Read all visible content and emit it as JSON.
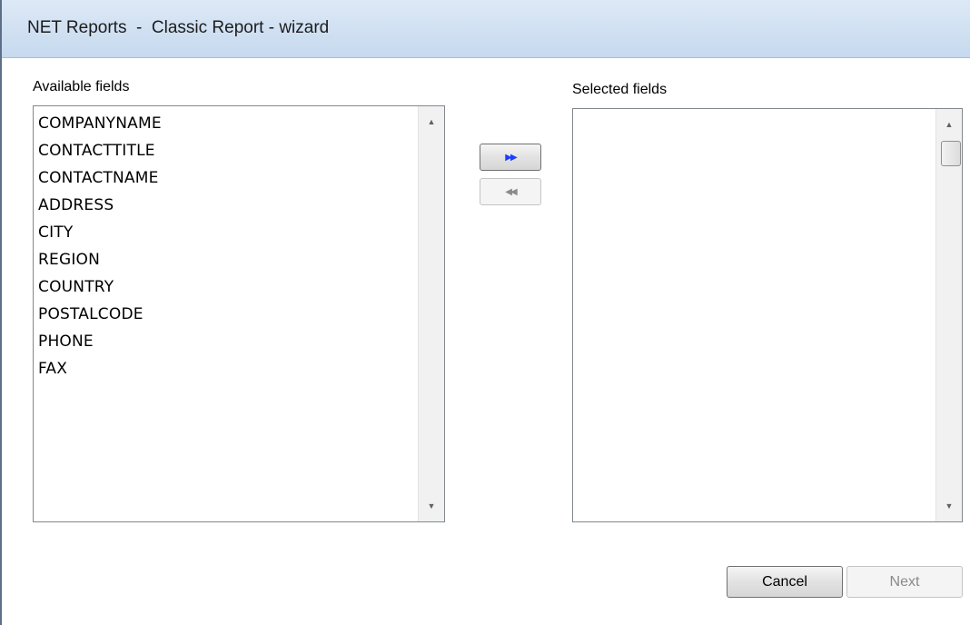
{
  "window": {
    "title": "NET Reports  -  Classic Report - wizard"
  },
  "available": {
    "label": "Available fields",
    "items": [
      "COMPANYNAME",
      "CONTACTTITLE",
      "CONTACTNAME",
      "ADDRESS",
      "CITY",
      "REGION",
      "COUNTRY",
      "POSTALCODE",
      "PHONE",
      "FAX"
    ]
  },
  "selected": {
    "label": "Selected fields",
    "items": []
  },
  "move_buttons": {
    "add_all_glyph": "▶▶",
    "remove_all_glyph": "◀◀"
  },
  "footer": {
    "cancel_label": "Cancel",
    "next_label": "Next"
  },
  "colors": {
    "title_bar": "#c6d9ef",
    "add_glyph": "#1a3cff",
    "disabled_text": "#8a8a8a"
  },
  "icons": {
    "scroll_up": "scroll-up-arrow-icon",
    "scroll_down": "scroll-down-arrow-icon"
  }
}
